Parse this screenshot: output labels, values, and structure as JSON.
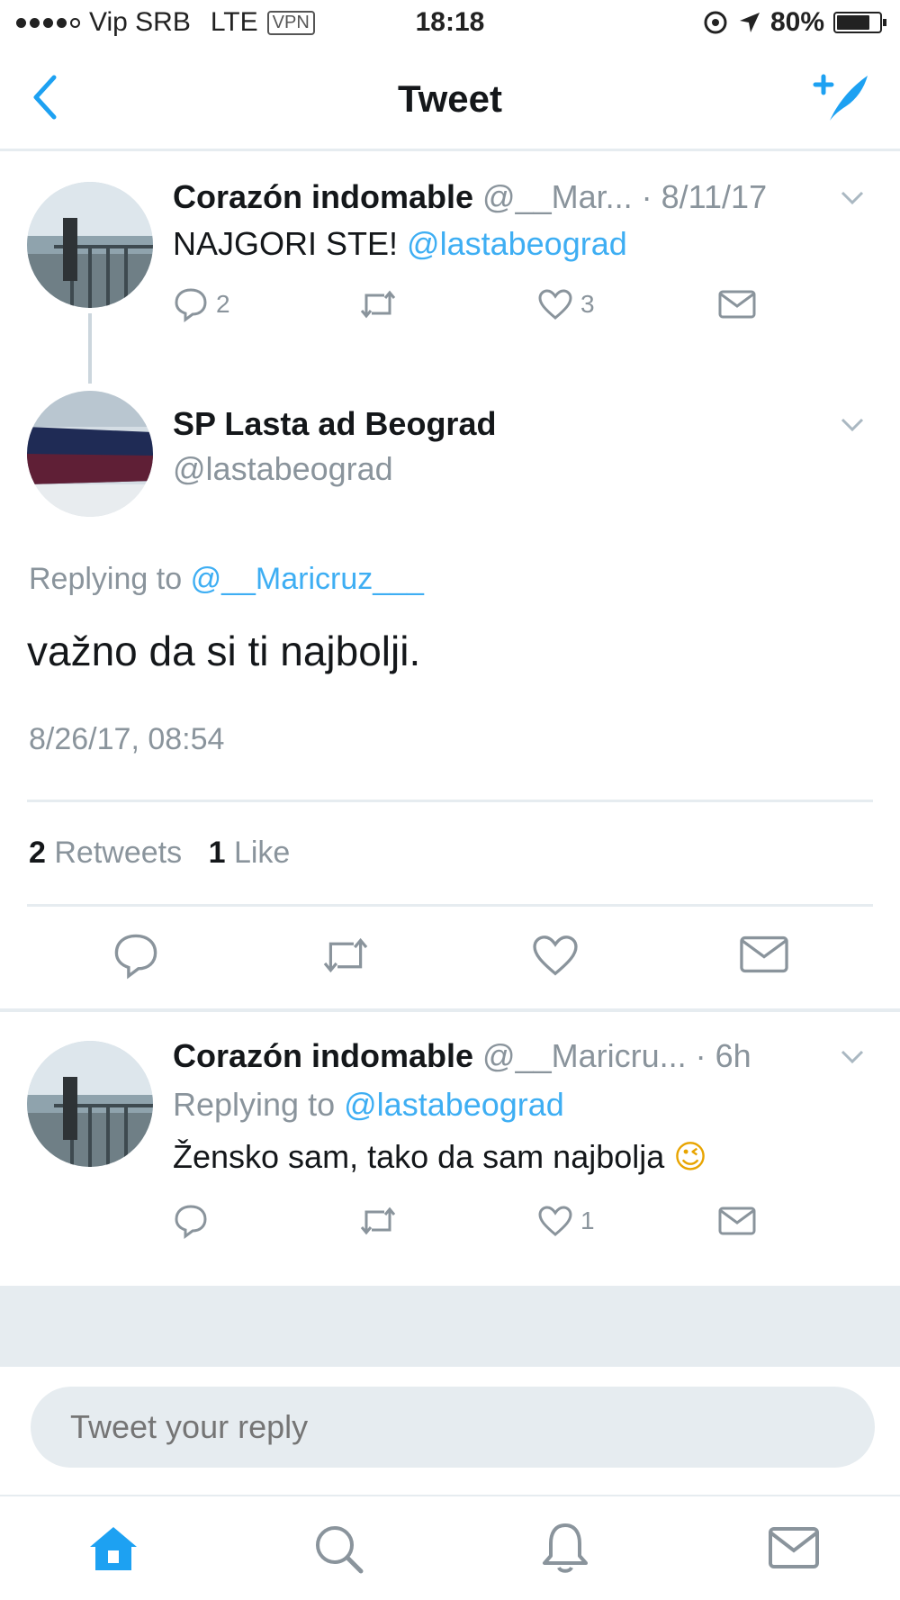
{
  "status_bar": {
    "carrier": "Vip SRB",
    "network": "LTE",
    "vpn": "VPN",
    "time": "18:18",
    "battery": "80%",
    "battery_level": 0.8
  },
  "nav": {
    "title": "Tweet"
  },
  "parent_tweet": {
    "display_name": "Corazón indomable",
    "handle": "@__Mar...",
    "date": "· 8/11/17",
    "text": "NAJGORI STE!",
    "mention": "@lastabeograd",
    "replies": "2",
    "likes": "3"
  },
  "main_tweet": {
    "display_name": "SP Lasta ad Beograd",
    "handle": "@lastabeograd",
    "replying_label": "Replying to",
    "replying_to": "@__Maricruz___",
    "text": "važno da si ti najbolji.",
    "timestamp": "8/26/17, 08:54",
    "retweet_count": "2",
    "retweet_label": "Retweets",
    "like_count": "1",
    "like_label": "Like"
  },
  "reply_tweet": {
    "display_name": "Corazón indomable",
    "handle": "@__Maricru...",
    "time": "· 6h",
    "replying_label": "Replying to",
    "replying_to": "@lastabeograd",
    "text": "Žensko sam, tako da sam najbolja",
    "emoji": "😉",
    "likes": "1"
  },
  "reply_input": {
    "placeholder": "Tweet your reply"
  },
  "colors": {
    "accent": "#1da1f2",
    "muted": "#8a949c",
    "divider": "#e6ecf0"
  },
  "tab_bar": {
    "icons": [
      "home-icon",
      "search-icon",
      "notifications-icon",
      "messages-icon"
    ]
  }
}
